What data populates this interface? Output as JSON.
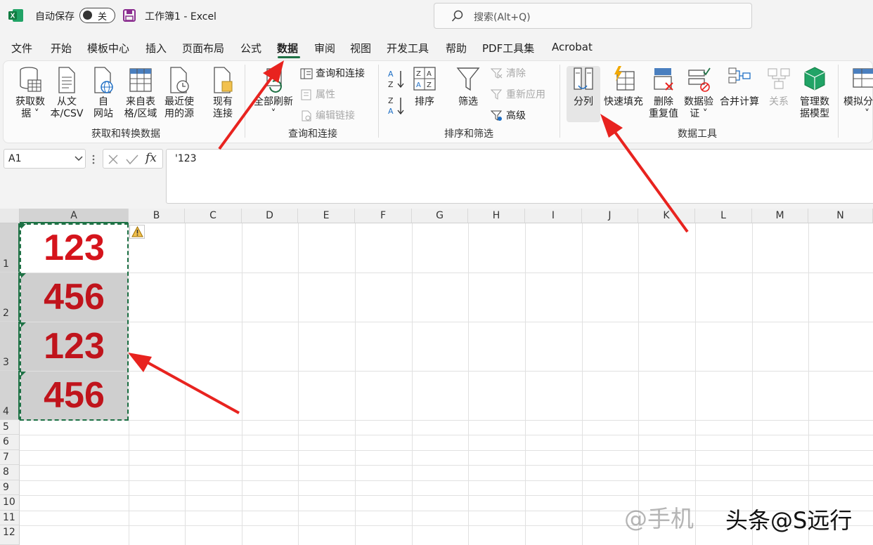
{
  "titlebar": {
    "autosave_label": "自动保存",
    "autosave_state": "关",
    "window_title": "工作簿1  -  Excel",
    "search_placeholder": "搜索(Alt+Q)"
  },
  "tabs": [
    "文件",
    "开始",
    "模板中心",
    "插入",
    "页面布局",
    "公式",
    "数据",
    "审阅",
    "视图",
    "开发工具",
    "帮助",
    "PDF工具集",
    "Acrobat"
  ],
  "active_tab": "数据",
  "ribbon": {
    "get_data": {
      "group_label": "获取和转换数据",
      "btn_get_data": [
        "获取数",
        "据 ˅"
      ],
      "btn_from_text": [
        "从文",
        "本/CSV"
      ],
      "btn_from_web": [
        "自",
        "网站"
      ],
      "btn_from_table": [
        "来自表",
        "格/区域"
      ],
      "btn_recent": [
        "最近使",
        "用的源"
      ],
      "btn_existing": [
        "现有",
        "连接"
      ]
    },
    "queries": {
      "group_label": "查询和连接",
      "btn_refresh_all": [
        "全部刷新",
        "˅"
      ],
      "queries_connections": "查询和连接",
      "properties": "属性",
      "edit_links": "编辑链接"
    },
    "sort_filter": {
      "group_label": "排序和筛选",
      "sort": "排序",
      "filter": "筛选",
      "clear": "清除",
      "reapply": "重新应用",
      "advanced": "高级"
    },
    "data_tools": {
      "group_label": "数据工具",
      "text_to_columns": "分列",
      "flash_fill": "快速填充",
      "remove_duplicates": [
        "删除",
        "重复值"
      ],
      "data_validation": [
        "数据验",
        "证 ˅"
      ],
      "consolidate": "合并计算",
      "relationships": "关系",
      "manage_model": [
        "管理数",
        "据模型"
      ]
    },
    "forecast": {
      "what_if": [
        "模拟分",
        "˅"
      ]
    }
  },
  "formula_bar": {
    "name_box": "A1",
    "fx_label": "fx",
    "formula": "'123"
  },
  "sheet": {
    "columns": [
      "A",
      "B",
      "C",
      "D",
      "E",
      "F",
      "G",
      "H",
      "I",
      "J",
      "K",
      "L",
      "M",
      "N"
    ],
    "rows": [
      "1",
      "2",
      "3",
      "4",
      "5",
      "6",
      "7",
      "8",
      "9",
      "10",
      "11",
      "12"
    ],
    "cells_a": [
      "123",
      "456",
      "123",
      "456"
    ]
  },
  "colors": {
    "accent": "#1e7145",
    "cell_text": "#d5141c",
    "arrow": "#e8231f"
  },
  "watermark": {
    "left": "@手机",
    "right": "头条@S远行"
  }
}
